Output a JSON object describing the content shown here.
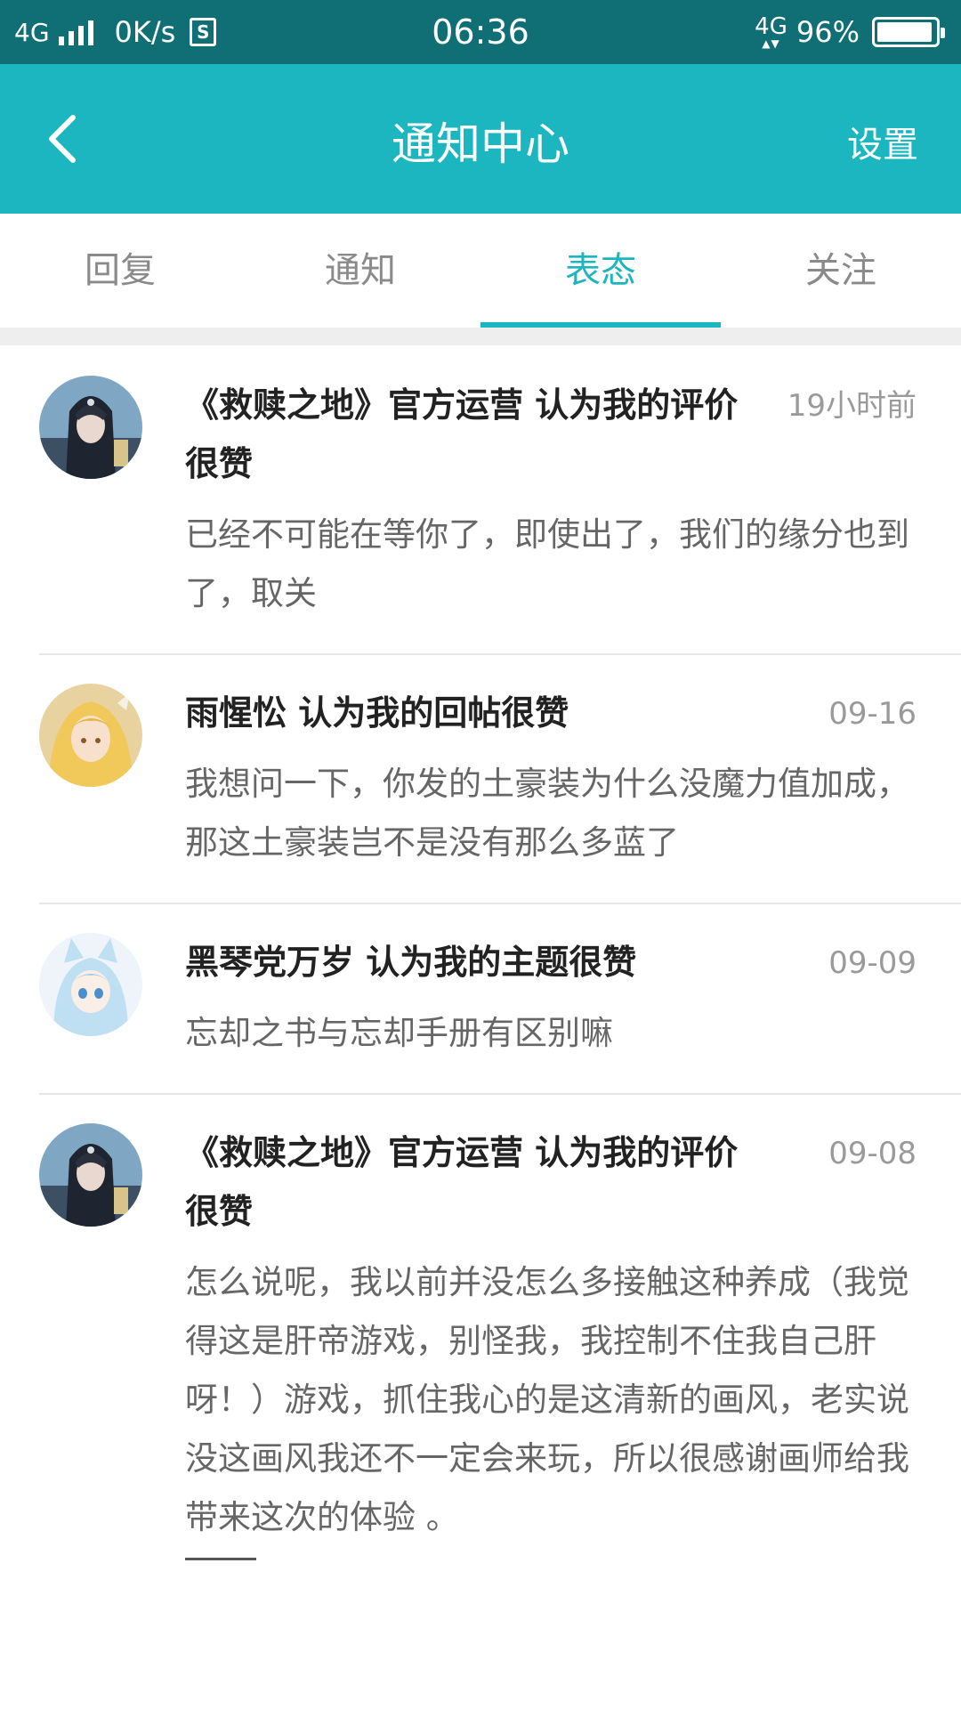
{
  "status_bar": {
    "network": "4G",
    "speed": "0K/s",
    "s_badge": "S",
    "time": "06:36",
    "network_right": "4G",
    "battery_text": "96%",
    "battery_level": 0.96
  },
  "header": {
    "back_icon": "chevron-left-icon",
    "title": "通知中心",
    "settings_label": "设置"
  },
  "tabs": [
    {
      "label": "回复",
      "active": false
    },
    {
      "label": "通知",
      "active": false
    },
    {
      "label": "表态",
      "active": true
    },
    {
      "label": "关注",
      "active": false
    }
  ],
  "items": [
    {
      "avatar": "hooded-character-avatar",
      "title": "《救赎之地》官方运营 认为我的评价很赞",
      "time": "19小时前",
      "body": "已经不可能在等你了，即使出了，我们的缘分也到了，取关"
    },
    {
      "avatar": "blonde-girl-avatar",
      "title": "雨惺忪 认为我的回帖很赞",
      "time": "09-16",
      "body": "我想问一下，你发的土豪装为什么没魔力值加成，那这土豪装岂不是没有那么多蓝了"
    },
    {
      "avatar": "catgirl-avatar",
      "title": "黑琴党万岁 认为我的主题很赞",
      "time": "09-09",
      "body": "忘却之书与忘却手册有区别嘛"
    },
    {
      "avatar": "hooded-character-avatar",
      "title": "《救赎之地》官方运营 认为我的评价很赞",
      "time": "09-08",
      "body": "怎么说呢，我以前并没怎么多接触这种养成（我觉得这是肝帝游戏，别怪我，我控制不住我自己肝呀！）游戏，抓住我心的是这清新的画风，老实说没这画风我还不一定会来玩，所以很感谢画师给我带来这次的体验 。"
    }
  ],
  "colors": {
    "status_bar": "#0f6f75",
    "header": "#1bb6bf",
    "accent": "#1bb6bf"
  }
}
